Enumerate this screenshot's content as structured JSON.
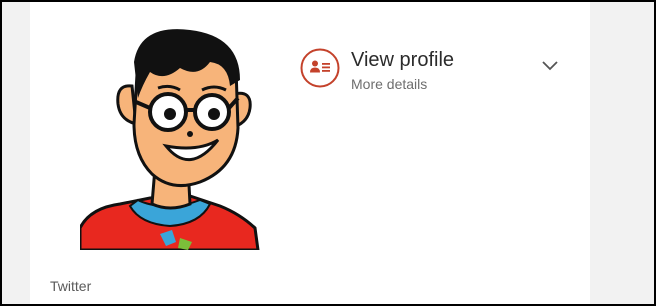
{
  "profile": {
    "title": "View profile",
    "subtitle": "More details",
    "icon": "contact-card-icon",
    "expand_icon": "chevron-down-icon"
  },
  "source": {
    "label": "Twitter"
  },
  "avatar": {
    "description_icon": "cartoon-avatar"
  },
  "colors": {
    "accent": "#c4422b",
    "card_bg": "#ffffff",
    "page_bg": "#f2f2f2",
    "title_text": "#2b2b2b",
    "secondary_text": "#6e6e6e"
  }
}
